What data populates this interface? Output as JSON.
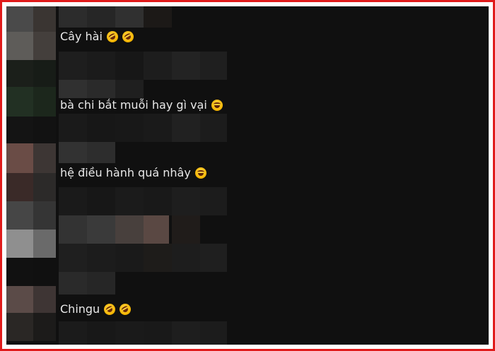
{
  "comments": [
    {
      "text": "Cây hài",
      "emojis": [
        "rofl-emoji",
        "rofl-emoji"
      ]
    },
    {
      "text": "bà chi bắt muỗi hay gì vại",
      "emojis": [
        "joy-emoji"
      ]
    },
    {
      "text": "hệ điều hành quá nhây",
      "emojis": [
        "joy-emoji"
      ]
    },
    {
      "text": "Chingu",
      "emojis": [
        "rofl-emoji",
        "rofl-emoji"
      ]
    }
  ],
  "colors": {
    "frame_border": "#e01b1b",
    "background": "#101010",
    "text": "#e8e8e8"
  }
}
